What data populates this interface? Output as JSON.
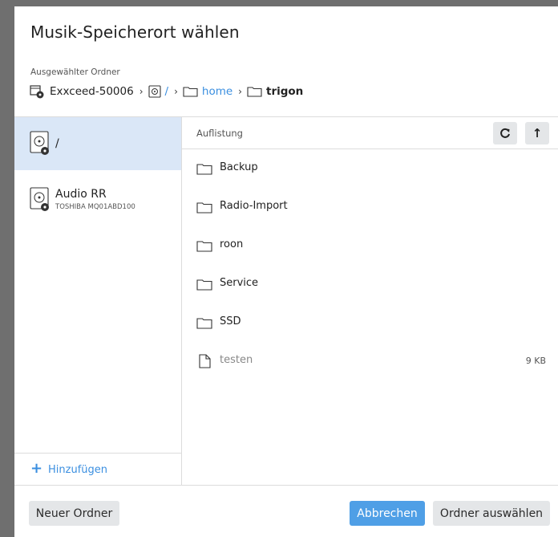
{
  "dialog": {
    "title": "Musik-Speicherort wählen",
    "selected_label": "Ausgewählter Ordner"
  },
  "breadcrumb": {
    "device": "Exxceed-50006",
    "root": "/",
    "home": "home",
    "current": "trigon",
    "separator": "›"
  },
  "sidebar": {
    "volumes": [
      {
        "name": "/",
        "subtitle": "",
        "active": true
      },
      {
        "name": "Audio RR",
        "subtitle": "TOSHIBA MQ01ABD100",
        "active": false
      }
    ],
    "add_label": "Hinzufügen",
    "add_icon": "+"
  },
  "listing": {
    "title": "Auflistung",
    "refresh_icon": "C",
    "up_icon": "↑",
    "items": [
      {
        "name": "Backup",
        "type": "folder",
        "size": ""
      },
      {
        "name": "Radio-Import",
        "type": "folder",
        "size": ""
      },
      {
        "name": "roon",
        "type": "folder",
        "size": ""
      },
      {
        "name": "Service",
        "type": "folder",
        "size": ""
      },
      {
        "name": "SSD",
        "type": "folder",
        "size": ""
      },
      {
        "name": "testen",
        "type": "file",
        "size": "9 KB"
      }
    ]
  },
  "footer": {
    "new_folder": "Neuer Ordner",
    "cancel": "Abbrechen",
    "choose": "Ordner auswählen"
  },
  "colors": {
    "accent": "#3b8fe0",
    "primary_button": "#4f9fe6",
    "selected_row": "#dae7f7",
    "backdrop": "#6f6f6f"
  }
}
